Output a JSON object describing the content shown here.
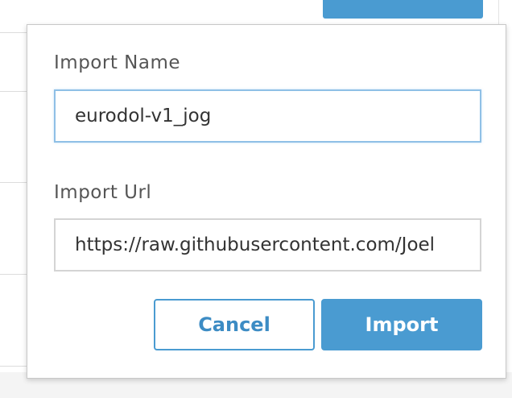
{
  "colors": {
    "accent": "#4a9bd1",
    "focus_border": "#8fc0e6",
    "label_text": "#555555"
  },
  "import_dialog": {
    "name_label": "Import Name",
    "name_value": "eurodol-v1_jog",
    "url_label": "Import Url",
    "url_value": "https://raw.githubusercontent.com/Joel",
    "cancel_label": "Cancel",
    "import_label": "Import"
  }
}
